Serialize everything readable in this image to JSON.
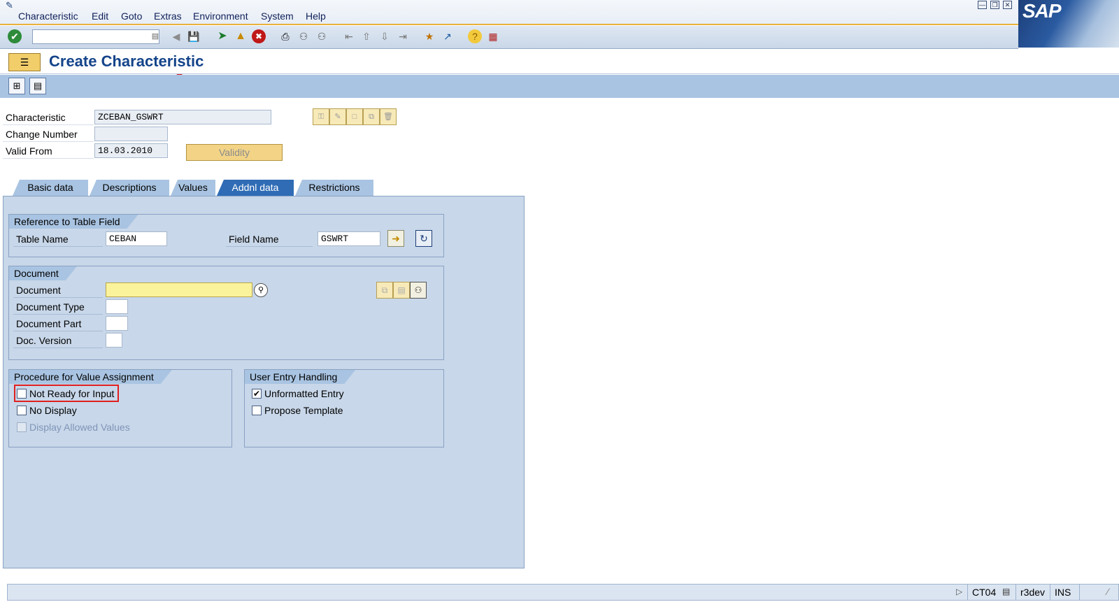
{
  "menu": {
    "items": [
      "Characteristic",
      "Edit",
      "Goto",
      "Extras",
      "Environment",
      "System",
      "Help"
    ]
  },
  "brand": {
    "logo_text": "SAP"
  },
  "toolbar": {
    "icons": [
      "enter-icon",
      "command-field",
      "back-icon",
      "save-icon",
      "back-nav-icon",
      "exit-icon",
      "cancel-icon",
      "print-icon",
      "find-icon",
      "find-next-icon",
      "first-page-icon",
      "previous-page-icon",
      "next-page-icon",
      "last-page-icon",
      "create-session-icon",
      "shortcut-icon",
      "help-icon",
      "customize-layout-icon"
    ]
  },
  "title": "Create Characteristic",
  "header_fields": {
    "characteristic_label": "Characteristic",
    "characteristic_value": "ZCEBAN_GSWRT",
    "change_number_label": "Change Number",
    "change_number_value": "",
    "valid_from_label": "Valid From",
    "valid_from_value": "18.03.2010",
    "validity_button": "Validity"
  },
  "tabs": [
    {
      "label": "Basic data",
      "active": false
    },
    {
      "label": "Descriptions",
      "active": false
    },
    {
      "label": "Values",
      "active": false
    },
    {
      "label": "Addnl data",
      "active": true
    },
    {
      "label": "Restrictions",
      "active": false
    }
  ],
  "reference": {
    "title": "Reference to Table Field",
    "table_name_label": "Table Name",
    "table_name_value": "CEBAN",
    "field_name_label": "Field Name",
    "field_name_value": "GSWRT"
  },
  "document": {
    "title": "Document",
    "document_label": "Document",
    "document_value": "",
    "doc_type_label": "Document Type",
    "doc_part_label": "Document Part",
    "doc_version_label": "Doc. Version"
  },
  "procedure": {
    "title": "Procedure for Value Assignment",
    "not_ready": {
      "label": "Not Ready for Input",
      "checked": false
    },
    "no_display": {
      "label": "No Display",
      "checked": false
    },
    "display_allowed": {
      "label": "Display Allowed Values",
      "checked": false,
      "disabled": true
    }
  },
  "user_entry": {
    "title": "User Entry Handling",
    "unformatted": {
      "label": "Unformatted Entry",
      "checked": true
    },
    "propose_template": {
      "label": "Propose Template",
      "checked": false
    }
  },
  "status": {
    "transaction": "CT04",
    "system": "r3dev",
    "mode": "INS"
  },
  "colors": {
    "accent": "#e9b13b",
    "active_tab": "#2f6cb5",
    "highlight": "#e02020",
    "title": "#14448a"
  }
}
